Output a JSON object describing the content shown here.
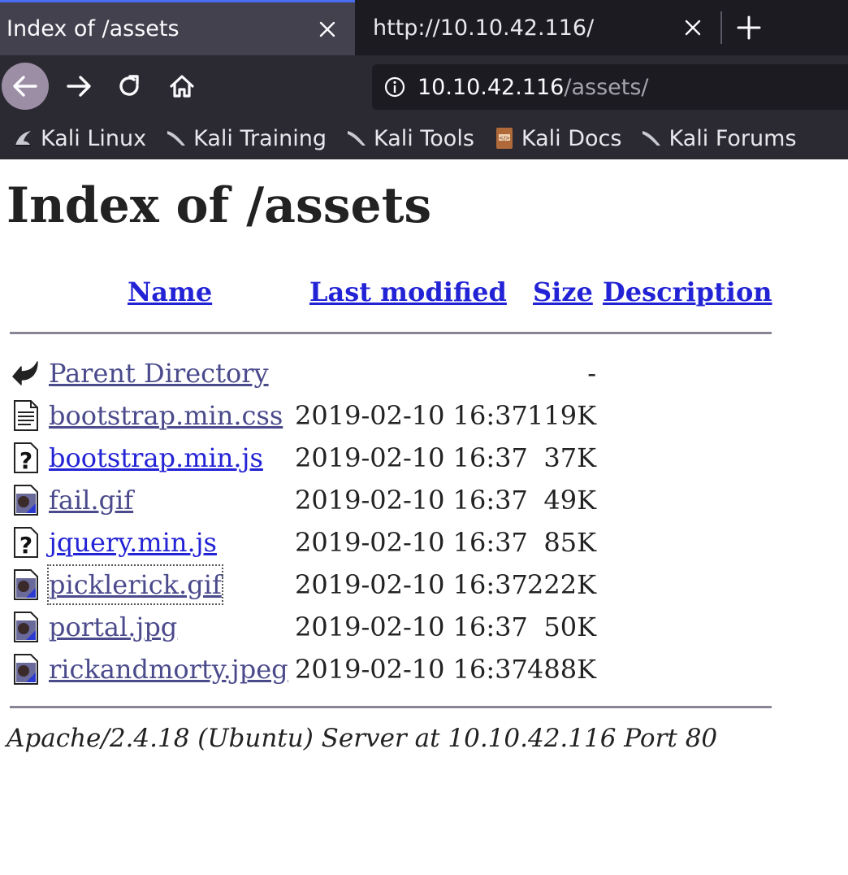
{
  "tabs": [
    {
      "title": "Index of /assets",
      "close_icon": "close-icon",
      "active": true
    },
    {
      "title": "http://10.10.42.116/",
      "close_icon": "close-icon",
      "active": false
    }
  ],
  "new_tab_icon": "plus-icon",
  "nav": {
    "back_icon": "arrow-left-icon",
    "forward_icon": "arrow-right-icon",
    "reload_icon": "reload-icon",
    "home_icon": "home-icon"
  },
  "urlbar": {
    "info_icon": "info-icon",
    "host": "10.10.42.116",
    "path": "/assets/"
  },
  "bookmarks": [
    {
      "label": "Kali Linux",
      "icon": "kali-dragon-icon"
    },
    {
      "label": "Kali Training",
      "icon": "kali-dragon-icon"
    },
    {
      "label": "Kali Tools",
      "icon": "kali-dragon-icon"
    },
    {
      "label": "Kali Docs",
      "icon": "kali-docs-icon"
    },
    {
      "label": "Kali Forums",
      "icon": "kali-dragon-icon"
    }
  ],
  "page": {
    "title": "Index of /assets",
    "columns": {
      "name": "Name",
      "last_modified": "Last modified",
      "size": "Size",
      "description": "Description"
    },
    "entries": [
      {
        "name": "Parent Directory",
        "date": "",
        "size": "-",
        "icon": "back-folder-icon",
        "visited": true
      },
      {
        "name": "bootstrap.min.css",
        "date": "2019-02-10 16:37",
        "size": "119K",
        "icon": "text-file-icon",
        "visited": true
      },
      {
        "name": "bootstrap.min.js",
        "date": "2019-02-10 16:37",
        "size": "37K",
        "icon": "unknown-file-icon",
        "visited": false
      },
      {
        "name": "fail.gif",
        "date": "2019-02-10 16:37",
        "size": "49K",
        "icon": "image-file-icon",
        "visited": true
      },
      {
        "name": "jquery.min.js",
        "date": "2019-02-10 16:37",
        "size": "85K",
        "icon": "unknown-file-icon",
        "visited": false
      },
      {
        "name": "picklerick.gif",
        "date": "2019-02-10 16:37",
        "size": "222K",
        "icon": "image-file-icon",
        "visited": true,
        "focused": true
      },
      {
        "name": "portal.jpg",
        "date": "2019-02-10 16:37",
        "size": "50K",
        "icon": "image-file-icon",
        "visited": true
      },
      {
        "name": "rickandmorty.jpeg",
        "date": "2019-02-10 16:37",
        "size": "488K",
        "icon": "image-file-icon",
        "visited": true
      }
    ],
    "footer": "Apache/2.4.18 (Ubuntu) Server at 10.10.42.116 Port 80"
  },
  "colors": {
    "link": "#2323d6",
    "visited_link": "#4a4a8c",
    "tab_active": "#42414d",
    "toolbar": "#2b2a33",
    "accent": "#4a6cf0"
  }
}
